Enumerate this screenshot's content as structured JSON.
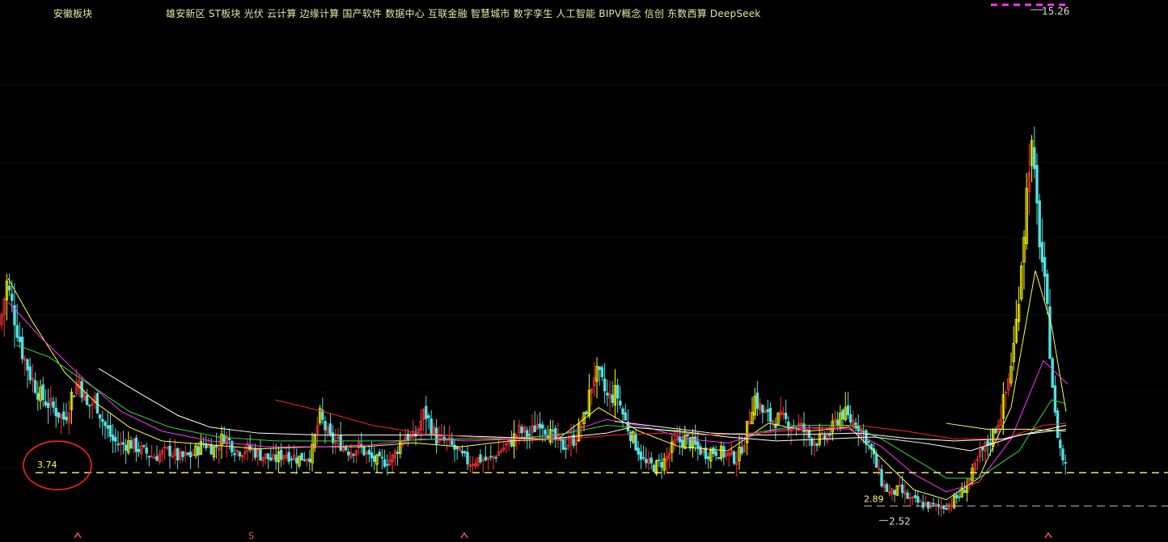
{
  "header": {
    "board_label": "安徽板块",
    "concept_tags": [
      "雄安新区",
      "ST板块",
      "光伏",
      "云计算",
      "边缘计算",
      "国产软件",
      "数据中心",
      "互联金融",
      "智慧城市",
      "数字孪生",
      "人工智能",
      "BIPV概念",
      "信创",
      "东数西算",
      "DeepSeek"
    ]
  },
  "colors": {
    "background": "#000000",
    "up_candle": "#ff3333",
    "down_candle": "#55e0e0",
    "limit_up_candle": "#ffff00",
    "ma_white": "#ffffff",
    "ma_yellow": "#ffff44",
    "ma_magenta": "#ff33ff",
    "ma_green": "#33dd33",
    "ma_red": "#ff2222",
    "support_line": "#ffff66",
    "annotation_circle": "#ff2222",
    "high_marker": "#ff33ff"
  },
  "chart_data": {
    "type": "candlestick",
    "y_range": [
      2.3,
      15.6
    ],
    "annotations": {
      "high_price_label": "15.26",
      "low_price_label": "2.52",
      "support_level": 3.74,
      "support_label": "3.74",
      "secondary_support_level": 2.89,
      "secondary_support_label": "2.89",
      "bottom_markers": [
        "S"
      ]
    },
    "close_path": [
      [
        0,
        7.5
      ],
      [
        8,
        8.6
      ],
      [
        15,
        8.0
      ],
      [
        28,
        6.8
      ],
      [
        38,
        6.2
      ],
      [
        50,
        5.7
      ],
      [
        60,
        5.5
      ],
      [
        70,
        5.3
      ],
      [
        80,
        5.1
      ],
      [
        88,
        5.7
      ],
      [
        98,
        6.1
      ],
      [
        108,
        5.4
      ],
      [
        118,
        5.6
      ],
      [
        128,
        5.0
      ],
      [
        140,
        4.55
      ],
      [
        150,
        4.45
      ],
      [
        160,
        4.5
      ],
      [
        175,
        4.3
      ],
      [
        190,
        4.15
      ],
      [
        210,
        4.3
      ],
      [
        222,
        4.1
      ],
      [
        238,
        4.2
      ],
      [
        252,
        4.5
      ],
      [
        265,
        4.35
      ],
      [
        278,
        4.7
      ],
      [
        292,
        4.3
      ],
      [
        308,
        4.35
      ],
      [
        322,
        4.2
      ],
      [
        338,
        4.05
      ],
      [
        352,
        4.25
      ],
      [
        368,
        4.1
      ],
      [
        385,
        4.2
      ],
      [
        395,
        5.2
      ],
      [
        408,
        4.6
      ],
      [
        420,
        4.5
      ],
      [
        432,
        4.3
      ],
      [
        445,
        4.4
      ],
      [
        458,
        4.1
      ],
      [
        470,
        4.0
      ],
      [
        485,
        4.1
      ],
      [
        500,
        4.7
      ],
      [
        512,
        4.6
      ],
      [
        525,
        5.3
      ],
      [
        540,
        4.6
      ],
      [
        555,
        4.5
      ],
      [
        568,
        4.2
      ],
      [
        580,
        4.0
      ],
      [
        592,
        4.1
      ],
      [
        605,
        4.05
      ],
      [
        618,
        4.3
      ],
      [
        630,
        4.5
      ],
      [
        642,
        4.8
      ],
      [
        655,
        4.7
      ],
      [
        668,
        5.1
      ],
      [
        680,
        4.7
      ],
      [
        695,
        4.4
      ],
      [
        710,
        4.6
      ],
      [
        722,
        5.1
      ],
      [
        735,
        6.3
      ],
      [
        742,
        6.1
      ],
      [
        752,
        5.6
      ],
      [
        762,
        5.8
      ],
      [
        772,
        5.1
      ],
      [
        785,
        4.5
      ],
      [
        798,
        3.95
      ],
      [
        810,
        3.9
      ],
      [
        822,
        4.05
      ],
      [
        835,
        4.5
      ],
      [
        848,
        4.6
      ],
      [
        860,
        4.4
      ],
      [
        872,
        4.25
      ],
      [
        885,
        4.3
      ],
      [
        898,
        4.2
      ],
      [
        912,
        4.1
      ],
      [
        922,
        4.7
      ],
      [
        932,
        5.7
      ],
      [
        942,
        5.3
      ],
      [
        952,
        5.1
      ],
      [
        965,
        5.1
      ],
      [
        978,
        5.0
      ],
      [
        990,
        4.9
      ],
      [
        1002,
        4.6
      ],
      [
        1015,
        4.55
      ],
      [
        1028,
        4.8
      ],
      [
        1040,
        5.3
      ],
      [
        1050,
        5.1
      ],
      [
        1060,
        5.0
      ],
      [
        1072,
        4.6
      ],
      [
        1082,
        4.0
      ],
      [
        1090,
        3.5
      ],
      [
        1100,
        3.2
      ],
      [
        1112,
        3.3
      ],
      [
        1125,
        3.05
      ],
      [
        1138,
        2.95
      ],
      [
        1150,
        2.9
      ],
      [
        1162,
        2.85
      ],
      [
        1175,
        2.95
      ],
      [
        1188,
        3.2
      ],
      [
        1200,
        3.6
      ],
      [
        1212,
        4.2
      ],
      [
        1225,
        4.6
      ],
      [
        1235,
        5.1
      ],
      [
        1245,
        5.9
      ],
      [
        1255,
        7.2
      ],
      [
        1262,
        9.0
      ],
      [
        1268,
        10.5
      ],
      [
        1274,
        12.3
      ],
      [
        1280,
        10.8
      ],
      [
        1288,
        9.2
      ],
      [
        1296,
        7.5
      ],
      [
        1304,
        5.2
      ],
      [
        1312,
        4.2
      ],
      [
        1320,
        3.8
      ]
    ],
    "moving_averages": [
      {
        "color": "#ffff44",
        "points": [
          [
            10,
            8.7
          ],
          [
            40,
            7.6
          ],
          [
            80,
            6.3
          ],
          [
            120,
            5.5
          ],
          [
            160,
            4.9
          ],
          [
            200,
            4.55
          ],
          [
            260,
            4.45
          ],
          [
            320,
            4.35
          ],
          [
            390,
            4.4
          ],
          [
            450,
            4.4
          ],
          [
            510,
            4.5
          ],
          [
            570,
            4.4
          ],
          [
            630,
            4.55
          ],
          [
            690,
            4.6
          ],
          [
            740,
            5.4
          ],
          [
            790,
            4.8
          ],
          [
            840,
            4.4
          ],
          [
            900,
            4.3
          ],
          [
            950,
            5.0
          ],
          [
            1000,
            4.8
          ],
          [
            1050,
            4.9
          ],
          [
            1090,
            4.1
          ],
          [
            1130,
            3.3
          ],
          [
            1170,
            3.05
          ],
          [
            1210,
            3.6
          ],
          [
            1250,
            5.4
          ],
          [
            1280,
            8.9
          ],
          [
            1300,
            7.5
          ],
          [
            1318,
            5.3
          ]
        ]
      },
      {
        "color": "#ff33ff",
        "points": [
          [
            10,
            8.1
          ],
          [
            50,
            7.2
          ],
          [
            100,
            6.2
          ],
          [
            150,
            5.3
          ],
          [
            200,
            4.8
          ],
          [
            260,
            4.55
          ],
          [
            330,
            4.4
          ],
          [
            400,
            4.4
          ],
          [
            460,
            4.45
          ],
          [
            520,
            4.6
          ],
          [
            580,
            4.55
          ],
          [
            640,
            4.6
          ],
          [
            700,
            4.75
          ],
          [
            750,
            5.1
          ],
          [
            800,
            4.9
          ],
          [
            850,
            4.6
          ],
          [
            900,
            4.5
          ],
          [
            950,
            4.8
          ],
          [
            1000,
            4.9
          ],
          [
            1050,
            4.85
          ],
          [
            1090,
            4.4
          ],
          [
            1130,
            3.7
          ],
          [
            1170,
            3.25
          ],
          [
            1210,
            3.5
          ],
          [
            1250,
            4.6
          ],
          [
            1290,
            6.6
          ],
          [
            1320,
            6.0
          ]
        ]
      },
      {
        "color": "#33dd33",
        "points": [
          [
            20,
            7.0
          ],
          [
            60,
            6.7
          ],
          [
            110,
            6.0
          ],
          [
            160,
            5.3
          ],
          [
            210,
            4.9
          ],
          [
            270,
            4.65
          ],
          [
            340,
            4.55
          ],
          [
            410,
            4.55
          ],
          [
            480,
            4.55
          ],
          [
            550,
            4.6
          ],
          [
            620,
            4.6
          ],
          [
            690,
            4.7
          ],
          [
            750,
            4.95
          ],
          [
            810,
            4.85
          ],
          [
            870,
            4.7
          ],
          [
            930,
            4.75
          ],
          [
            990,
            4.95
          ],
          [
            1050,
            4.95
          ],
          [
            1090,
            4.6
          ],
          [
            1130,
            4.1
          ],
          [
            1170,
            3.6
          ],
          [
            1210,
            3.6
          ],
          [
            1260,
            4.3
          ],
          [
            1300,
            5.6
          ],
          [
            1318,
            5.5
          ]
        ]
      },
      {
        "color": "#ffffff",
        "points": [
          [
            122,
            6.4
          ],
          [
            170,
            5.8
          ],
          [
            220,
            5.2
          ],
          [
            260,
            4.9
          ],
          [
            320,
            4.75
          ],
          [
            400,
            4.7
          ],
          [
            470,
            4.7
          ],
          [
            540,
            4.7
          ],
          [
            610,
            4.65
          ],
          [
            680,
            4.6
          ],
          [
            750,
            4.75
          ],
          [
            780,
            4.9
          ],
          [
            840,
            4.8
          ],
          [
            900,
            4.65
          ],
          [
            960,
            4.55
          ],
          [
            1020,
            4.6
          ],
          [
            1080,
            4.65
          ],
          [
            1140,
            4.5
          ],
          [
            1200,
            4.3
          ],
          [
            1260,
            4.7
          ],
          [
            1318,
            4.85
          ]
        ]
      },
      {
        "color": "#ff2222",
        "points": [
          [
            340,
            5.6
          ],
          [
            400,
            5.3
          ],
          [
            460,
            4.95
          ],
          [
            520,
            4.75
          ],
          [
            580,
            4.65
          ],
          [
            640,
            4.6
          ],
          [
            700,
            4.6
          ],
          [
            760,
            4.7
          ],
          [
            820,
            4.75
          ],
          [
            880,
            4.7
          ],
          [
            940,
            4.75
          ],
          [
            1000,
            4.85
          ],
          [
            1060,
            4.95
          ],
          [
            1120,
            4.8
          ],
          [
            1180,
            4.6
          ],
          [
            1240,
            4.6
          ],
          [
            1290,
            4.95
          ],
          [
            1318,
            5.0
          ]
        ]
      }
    ],
    "overlay_lines": [
      {
        "color": "#ffffff",
        "points": [
          [
            760,
            5.05
          ],
          [
            820,
            4.9
          ],
          [
            880,
            4.75
          ],
          [
            940,
            4.7
          ],
          [
            1000,
            4.72
          ],
          [
            1060,
            4.75
          ],
          [
            1120,
            4.62
          ],
          [
            1180,
            4.55
          ],
          [
            1240,
            4.6
          ],
          [
            1318,
            4.95
          ]
        ]
      },
      {
        "color": "#ffff66",
        "points": [
          [
            1170,
            5.0
          ],
          [
            1220,
            4.85
          ],
          [
            1270,
            4.85
          ],
          [
            1318,
            4.8
          ]
        ]
      }
    ]
  }
}
